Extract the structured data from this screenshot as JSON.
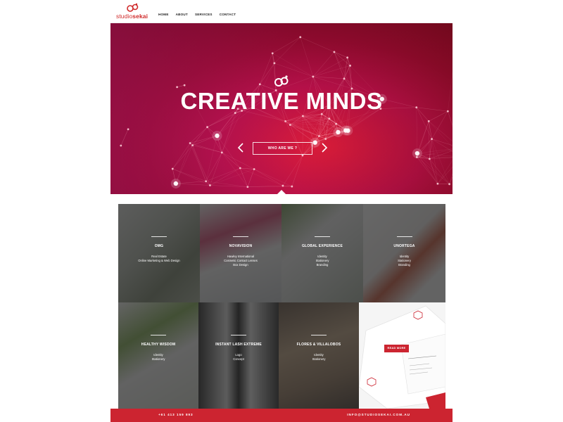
{
  "brand": {
    "logo_studio": "studio",
    "logo_sekai": "sekai",
    "accent": "#cc2430"
  },
  "nav": {
    "items": [
      {
        "label": "HOME"
      },
      {
        "label": "ABOUT"
      },
      {
        "label": "SERVICES"
      },
      {
        "label": "CONTACT"
      }
    ]
  },
  "hero": {
    "title": "CREATIVE MINDS",
    "button_label": "WHO ARE WE ?",
    "prev_icon": "chevron-left-icon",
    "next_icon": "chevron-right-icon"
  },
  "portfolio": {
    "tiles": [
      {
        "title": "OMG",
        "services": [
          "Real Estate",
          "Online Marketing & Web Design"
        ]
      },
      {
        "title": "NOVAVISION",
        "services": [
          "Hawley International",
          "Cosmetic Contact Lenses",
          "Box Design"
        ]
      },
      {
        "title": "GLOBAL EXPERIENCE",
        "services": [
          "Identity",
          "Stationery",
          "Branding"
        ]
      },
      {
        "title": "UNORTEGA",
        "services": [
          "Identity",
          "Stationery",
          "Branding"
        ]
      },
      {
        "title": "HEALTHY WISDOM",
        "services": [
          "Identity",
          "Stationery"
        ]
      },
      {
        "title": "INSTANT LASH EXTREME",
        "services": [
          "Logo",
          "Concept"
        ]
      },
      {
        "title": "FLORES & VILLALOBOS",
        "services": [
          "Identity",
          "Stationery"
        ]
      }
    ],
    "read_more_label": "READ MORE"
  },
  "footer": {
    "phone": "+61 413 159 893",
    "email": "INFO@STUDIOSEKAI.COM.AU"
  }
}
